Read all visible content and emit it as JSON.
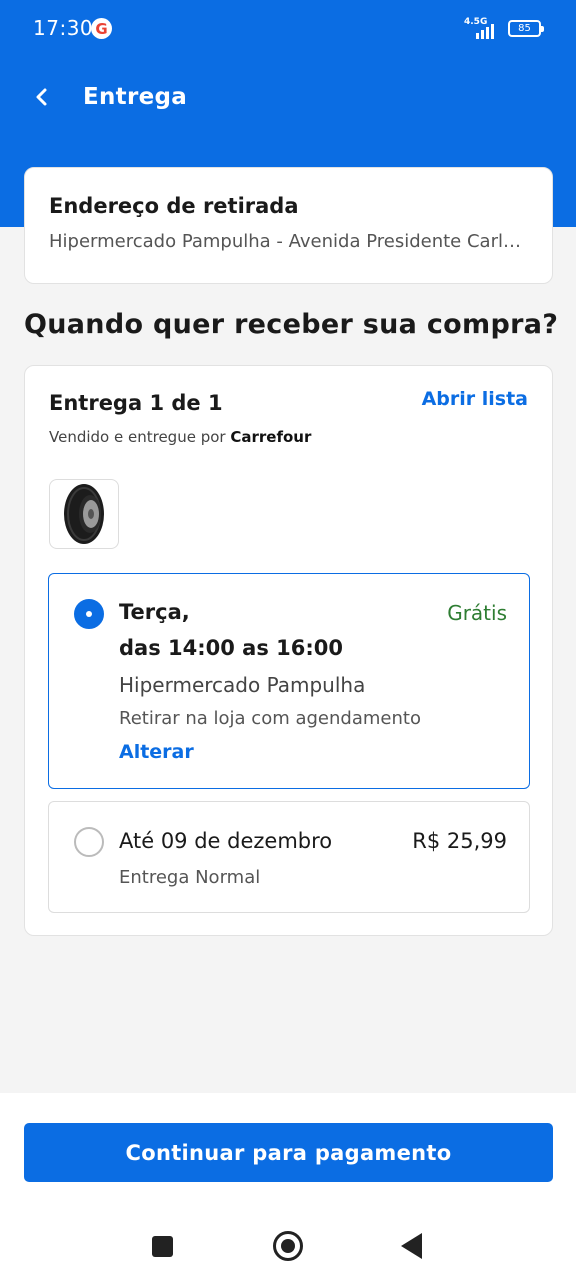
{
  "status_bar": {
    "time": "17:30",
    "network": "4.5G",
    "battery": "85"
  },
  "header": {
    "title": "Entrega"
  },
  "pickup_address": {
    "title": "Endereço de retirada",
    "address": "Hipermercado Pampulha - Avenida Presidente Carlos Luz"
  },
  "question": "Quando quer receber sua compra?",
  "shipment": {
    "title": "Entrega 1 de 1",
    "open_list_label": "Abrir lista",
    "seller_prefix": "Vendido e entregue por",
    "seller_name": "Carrefour",
    "product_icon": "tire-icon",
    "options": [
      {
        "selected": true,
        "day": "Terça,",
        "time_window": "das 14:00 as 16:00",
        "store": "Hipermercado Pampulha",
        "method": "Retirar na loja com agendamento",
        "change_label": "Alterar",
        "price": "Grátis"
      },
      {
        "selected": false,
        "day": "Até 09 de dezembro",
        "method": "Entrega Normal",
        "price": "R$ 25,99"
      }
    ]
  },
  "footer": {
    "continue_label": "Continuar para pagamento"
  },
  "colors": {
    "primary": "#0b6de3",
    "free_green": "#2e7d32"
  }
}
